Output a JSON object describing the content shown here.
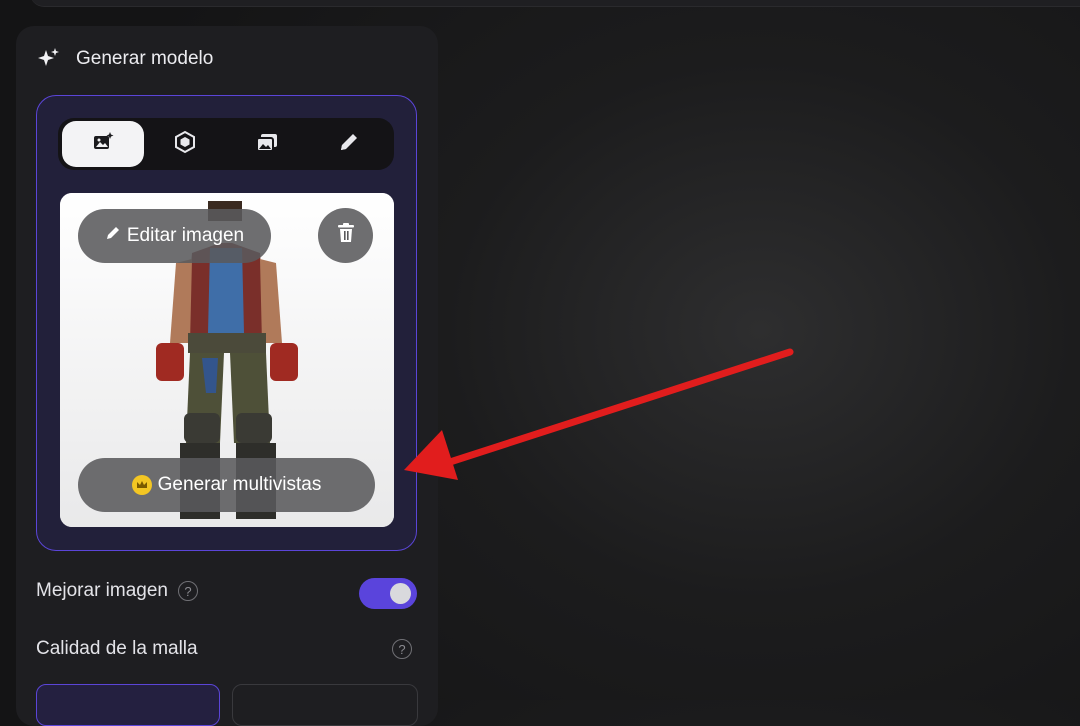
{
  "panel": {
    "title": "Generar modelo",
    "title_icon": "sparkle-icon"
  },
  "tabs": [
    {
      "icon": "image-sparkle-icon",
      "active": true
    },
    {
      "icon": "cube-icon",
      "active": false
    },
    {
      "icon": "multi-image-icon",
      "active": false
    },
    {
      "icon": "pencil-icon",
      "active": false
    }
  ],
  "preview": {
    "edit_label": "Editar imagen",
    "delete_icon": "trash-icon",
    "multiview_label": "Generar multivistas",
    "premium_icon": "crown-icon"
  },
  "settings": {
    "enhance_label": "Mejorar imagen",
    "enhance_on": true,
    "mesh_quality_label": "Calidad de la malla"
  },
  "colors": {
    "accent": "#5b45d8",
    "arrow": "#e11d1d",
    "premium": "#f3c623"
  }
}
